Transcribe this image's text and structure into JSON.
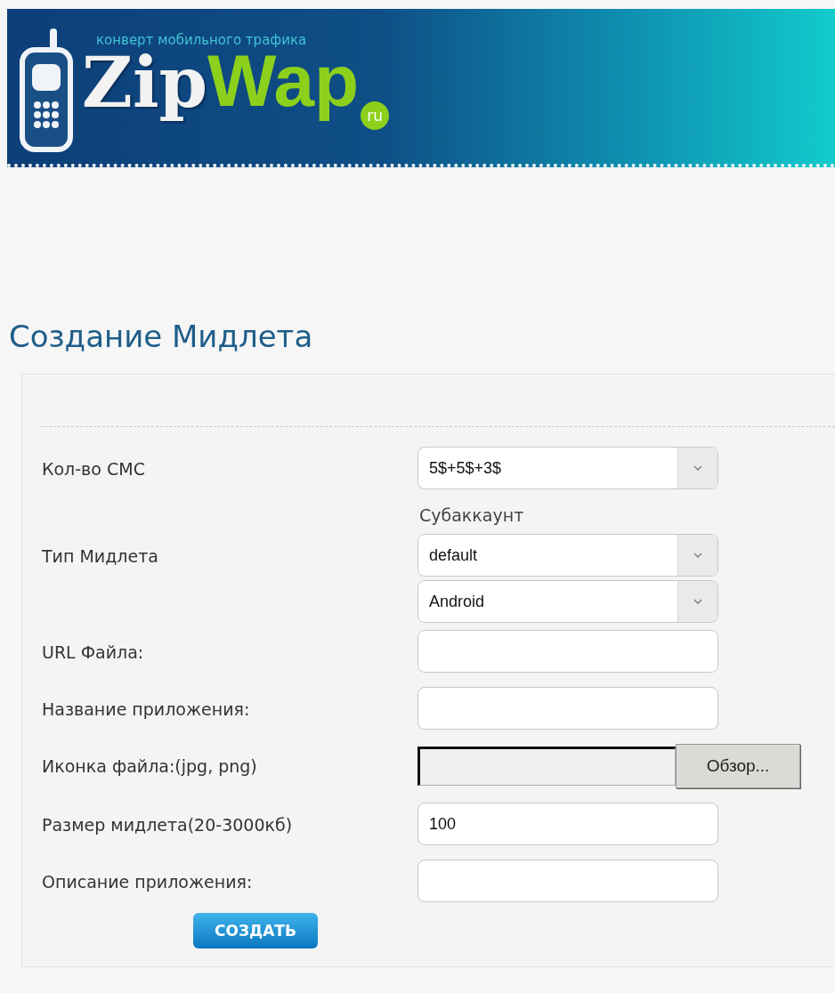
{
  "header": {
    "tagline": "конверт мобильного трафика",
    "logo_part1": "Zip",
    "logo_part2": "Wap",
    "logo_badge": "ru"
  },
  "title": "Создание Мидлета",
  "rows": [
    {
      "label": "Кол-во СМС",
      "controls": [
        {
          "kind": "select",
          "value": "5$+5$+3$"
        }
      ]
    },
    {
      "label": "Тип Мидлета",
      "caption": "Субаккаунт",
      "controls": [
        {
          "kind": "select",
          "value": "default"
        },
        {
          "kind": "select",
          "value": "Android"
        }
      ]
    },
    {
      "label": "URL Файла:",
      "controls": [
        {
          "kind": "text"
        }
      ]
    },
    {
      "label": "Название приложения:",
      "controls": [
        {
          "kind": "text"
        }
      ]
    },
    {
      "label": "Иконка файла:(jpg, png)",
      "controls": [
        {
          "kind": "file",
          "button": "Обзор..."
        }
      ]
    },
    {
      "label": "Размер мидлета(20-3000кб)",
      "controls": [
        {
          "kind": "text",
          "value": "100"
        }
      ]
    },
    {
      "label": "Описание приложения:",
      "controls": [
        {
          "kind": "text"
        }
      ]
    }
  ],
  "submit": "СОЗДАТЬ"
}
